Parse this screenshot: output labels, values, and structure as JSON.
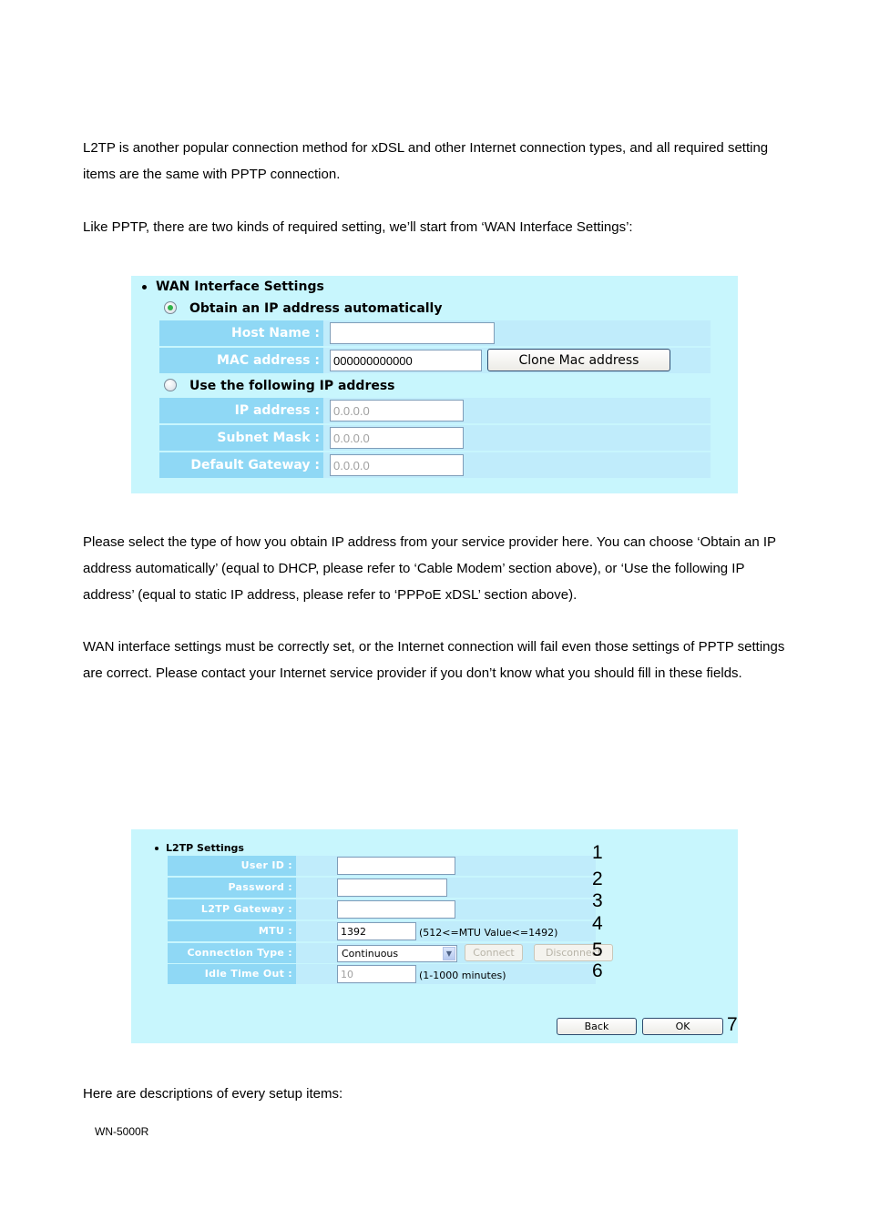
{
  "paragraphs": {
    "intro": "L2TP is another popular connection method for xDSL and other Internet connection types, and all required setting items are the same with PPTP connection.",
    "like_pptp": "Like PPTP, there are two kinds of required setting, we’ll start from ‘WAN Interface Settings’:",
    "select_type": "Please select the type of how you obtain IP address from your service provider here. You can choose ‘Obtain an IP address automatically’ (equal to DHCP, please refer to ‘Cable Modem’ section above), or ‘Use the following IP address’ (equal to static IP address, please refer to ‘PPPoE xDSL’ section above).",
    "wan_warning": "WAN interface settings must be correctly set, or the Internet connection will fail even those settings of PPTP settings are correct. Please contact your Internet service provider if you don’t know what you should fill in these fields.",
    "descriptions": "Here are descriptions of every setup items:"
  },
  "wan_panel": {
    "title": "WAN Interface Settings",
    "option_auto": {
      "label": "Obtain an IP address automatically",
      "selected": true
    },
    "host_name": {
      "label": "Host Name :",
      "value": ""
    },
    "mac_address": {
      "label": "MAC address :",
      "value": "000000000000"
    },
    "clone_mac_button": "Clone Mac address",
    "option_static": {
      "label": "Use the following IP address",
      "selected": false
    },
    "ip_address": {
      "label": "IP address :",
      "value": "0.0.0.0"
    },
    "subnet_mask": {
      "label": "Subnet Mask :",
      "value": "0.0.0.0"
    },
    "default_gateway": {
      "label": "Default Gateway :",
      "value": "0.0.0.0"
    }
  },
  "l2tp_panel": {
    "title": "L2TP Settings",
    "user_id": {
      "label": "User ID :",
      "value": ""
    },
    "password": {
      "label": "Password :",
      "value": ""
    },
    "gateway": {
      "label": "L2TP Gateway :",
      "value": ""
    },
    "mtu": {
      "label": "MTU :",
      "value": "1392",
      "hint": "(512<=MTU Value<=1492)"
    },
    "connection_type": {
      "label": "Connection Type :",
      "selected": "Continuous",
      "connect_button": "Connect",
      "disconnect_button": "Disconnect"
    },
    "idle_timeout": {
      "label": "Idle Time Out :",
      "value": "10",
      "hint": "(1-1000 minutes)"
    },
    "back_button": "Back",
    "ok_button": "OK",
    "callouts": [
      "1",
      "2",
      "3",
      "4",
      "5",
      "6",
      "7"
    ]
  },
  "footer": {
    "model": "WN-5000R"
  }
}
